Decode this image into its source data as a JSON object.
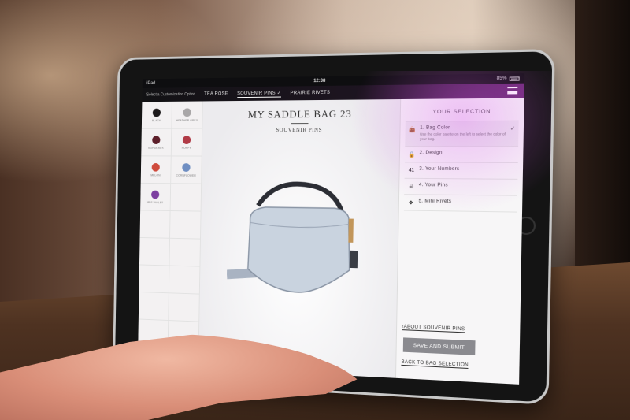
{
  "status_bar": {
    "device": "iPad",
    "time": "12:38",
    "battery": "85%"
  },
  "nav": {
    "prompt": "Select a Customization Option",
    "tabs": [
      "TEA ROSE",
      "SOUVENIR PINS",
      "PRAIRIE RIVETS"
    ],
    "active_tab": "SOUVENIR PINS"
  },
  "palette": {
    "swatches": [
      {
        "label": "BLACK",
        "color": "#1c1a1b"
      },
      {
        "label": "HEATHER GREY",
        "color": "#a9a7a8"
      },
      {
        "label": "BORDEAUX",
        "color": "#5d1f2a"
      },
      {
        "label": "POPPY",
        "color": "#b03a46"
      },
      {
        "label": "MELON",
        "color": "#cf4a3c"
      },
      {
        "label": "CORNFLOWER",
        "color": "#6f8ec2"
      },
      {
        "label": "IRIS VIOLET",
        "color": "#7d3fa0"
      }
    ]
  },
  "product": {
    "title": "MY SADDLE BAG 23",
    "subtitle": "SOUVENIR PINS",
    "bag_color": "#c9d3df"
  },
  "sidebar": {
    "heading": "YOUR SELECTION",
    "steps": [
      {
        "label": "1. Bag Color",
        "desc": "Use the color palette on the left to select the color of your bag.",
        "icon": "bag-icon"
      },
      {
        "label": "2. Design",
        "desc": "",
        "icon": "lock-icon"
      },
      {
        "label": "3. Your Numbers",
        "desc": "",
        "icon": "numbers-icon"
      },
      {
        "label": "4. Your Pins",
        "desc": "",
        "icon": "skull-icon"
      },
      {
        "label": "5. Mini Rivets",
        "desc": "",
        "icon": "rivet-icon"
      }
    ],
    "about_link": "ABOUT SOUVENIR PINS",
    "save_label": "SAVE AND SUBMIT",
    "back_link": "BACK TO BAG SELECTION"
  }
}
